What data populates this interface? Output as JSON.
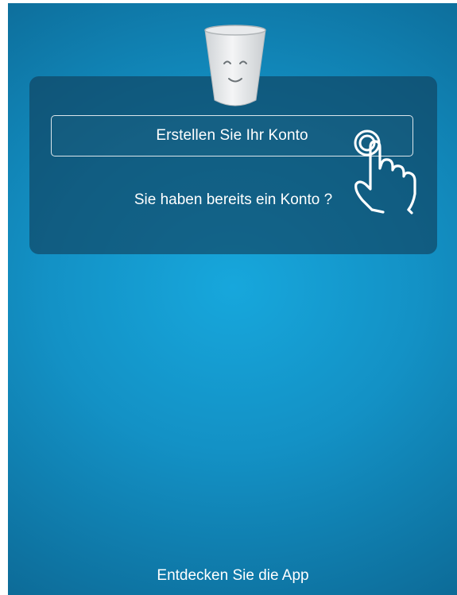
{
  "welcome": {
    "create_account_label": "Erstellen Sie Ihr Konto",
    "existing_account_label": "Sie haben bereits ein Konto ?",
    "discover_app_label": "Entdecken Sie die App"
  },
  "icons": {
    "mascot": "smiling-cup-icon",
    "gesture": "tap-hand-icon"
  },
  "colors": {
    "background_center": "#17a7dc",
    "background_edge": "#0b5578",
    "card": "#103e58",
    "text": "#ffffff"
  }
}
